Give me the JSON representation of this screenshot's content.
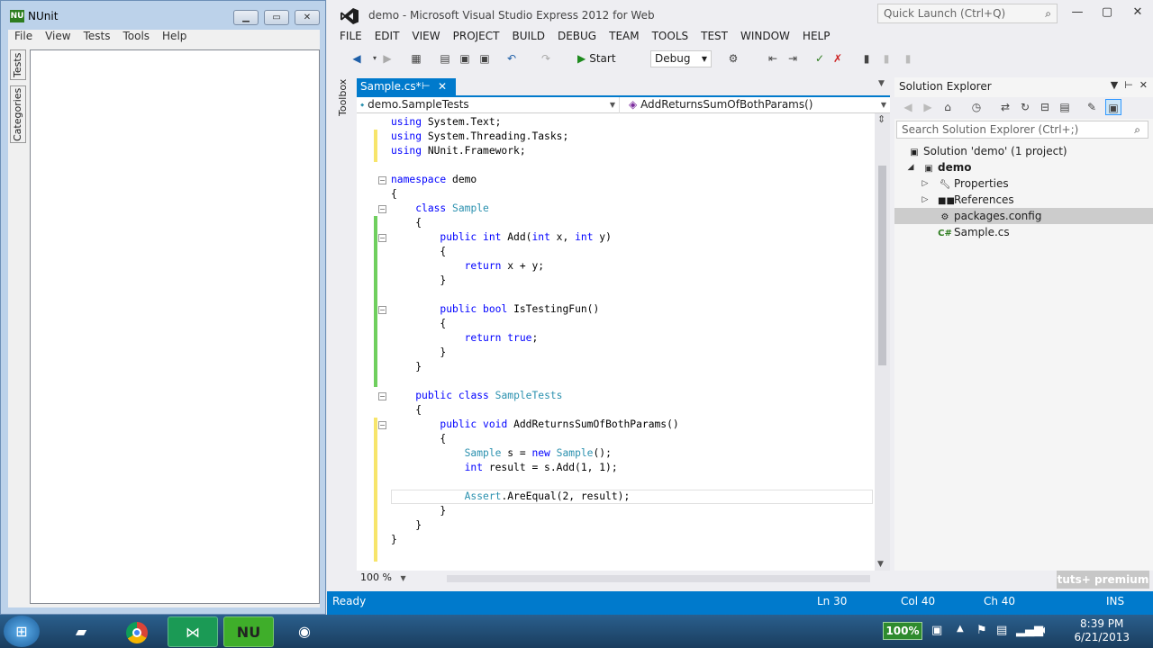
{
  "nunit": {
    "title": "NUnit",
    "menu": [
      "File",
      "View",
      "Tests",
      "Tools",
      "Help"
    ],
    "side_tabs": [
      "Tests",
      "Categories"
    ]
  },
  "vs": {
    "title": "demo - Microsoft Visual Studio Express 2012 for Web",
    "quick_launch_placeholder": "Quick Launch (Ctrl+Q)",
    "menu": [
      "FILE",
      "EDIT",
      "VIEW",
      "PROJECT",
      "BUILD",
      "DEBUG",
      "TEAM",
      "TOOLS",
      "TEST",
      "WINDOW",
      "HELP"
    ],
    "toolbar": {
      "start_label": "Start",
      "configuration": "Debug"
    },
    "toolbox_label": "Toolbox",
    "doc_tab": {
      "label": "Sample.cs*"
    },
    "nav": {
      "class": "demo.SampleTests",
      "member": "AddReturnsSumOfBothParams()"
    },
    "code": [
      "using System.Text;",
      "using System.Threading.Tasks;",
      "using NUnit.Framework;",
      "",
      "namespace demo",
      "{",
      "    class Sample",
      "    {",
      "        public int Add(int x, int y)",
      "        {",
      "            return x + y;",
      "        }",
      "",
      "        public bool IsTestingFun()",
      "        {",
      "            return true;",
      "        }",
      "    }",
      "",
      "    public class SampleTests",
      "    {",
      "        public void AddReturnsSumOfBothParams()",
      "        {",
      "            Sample s = new Sample();",
      "            int result = s.Add(1, 1);",
      "",
      "            Assert.AreEqual(2, result);",
      "        }",
      "    }",
      "}"
    ],
    "zoom": "100 %",
    "solution_explorer": {
      "title": "Solution Explorer",
      "search_placeholder": "Search Solution Explorer (Ctrl+;)",
      "items": [
        {
          "label": "Solution 'demo' (1 project)"
        },
        {
          "label": "demo"
        },
        {
          "label": "Properties"
        },
        {
          "label": "References"
        },
        {
          "label": "packages.config"
        },
        {
          "label": "Sample.cs"
        }
      ]
    },
    "status": {
      "ready": "Ready",
      "ln": "Ln 30",
      "col": "Col 40",
      "ch": "Ch 40",
      "mode": "INS"
    },
    "watermark": "tuts+ premium"
  },
  "taskbar": {
    "battery": "100%",
    "time": "8:39 PM",
    "date": "6/21/2013",
    "nunit_app_label": "NU"
  }
}
